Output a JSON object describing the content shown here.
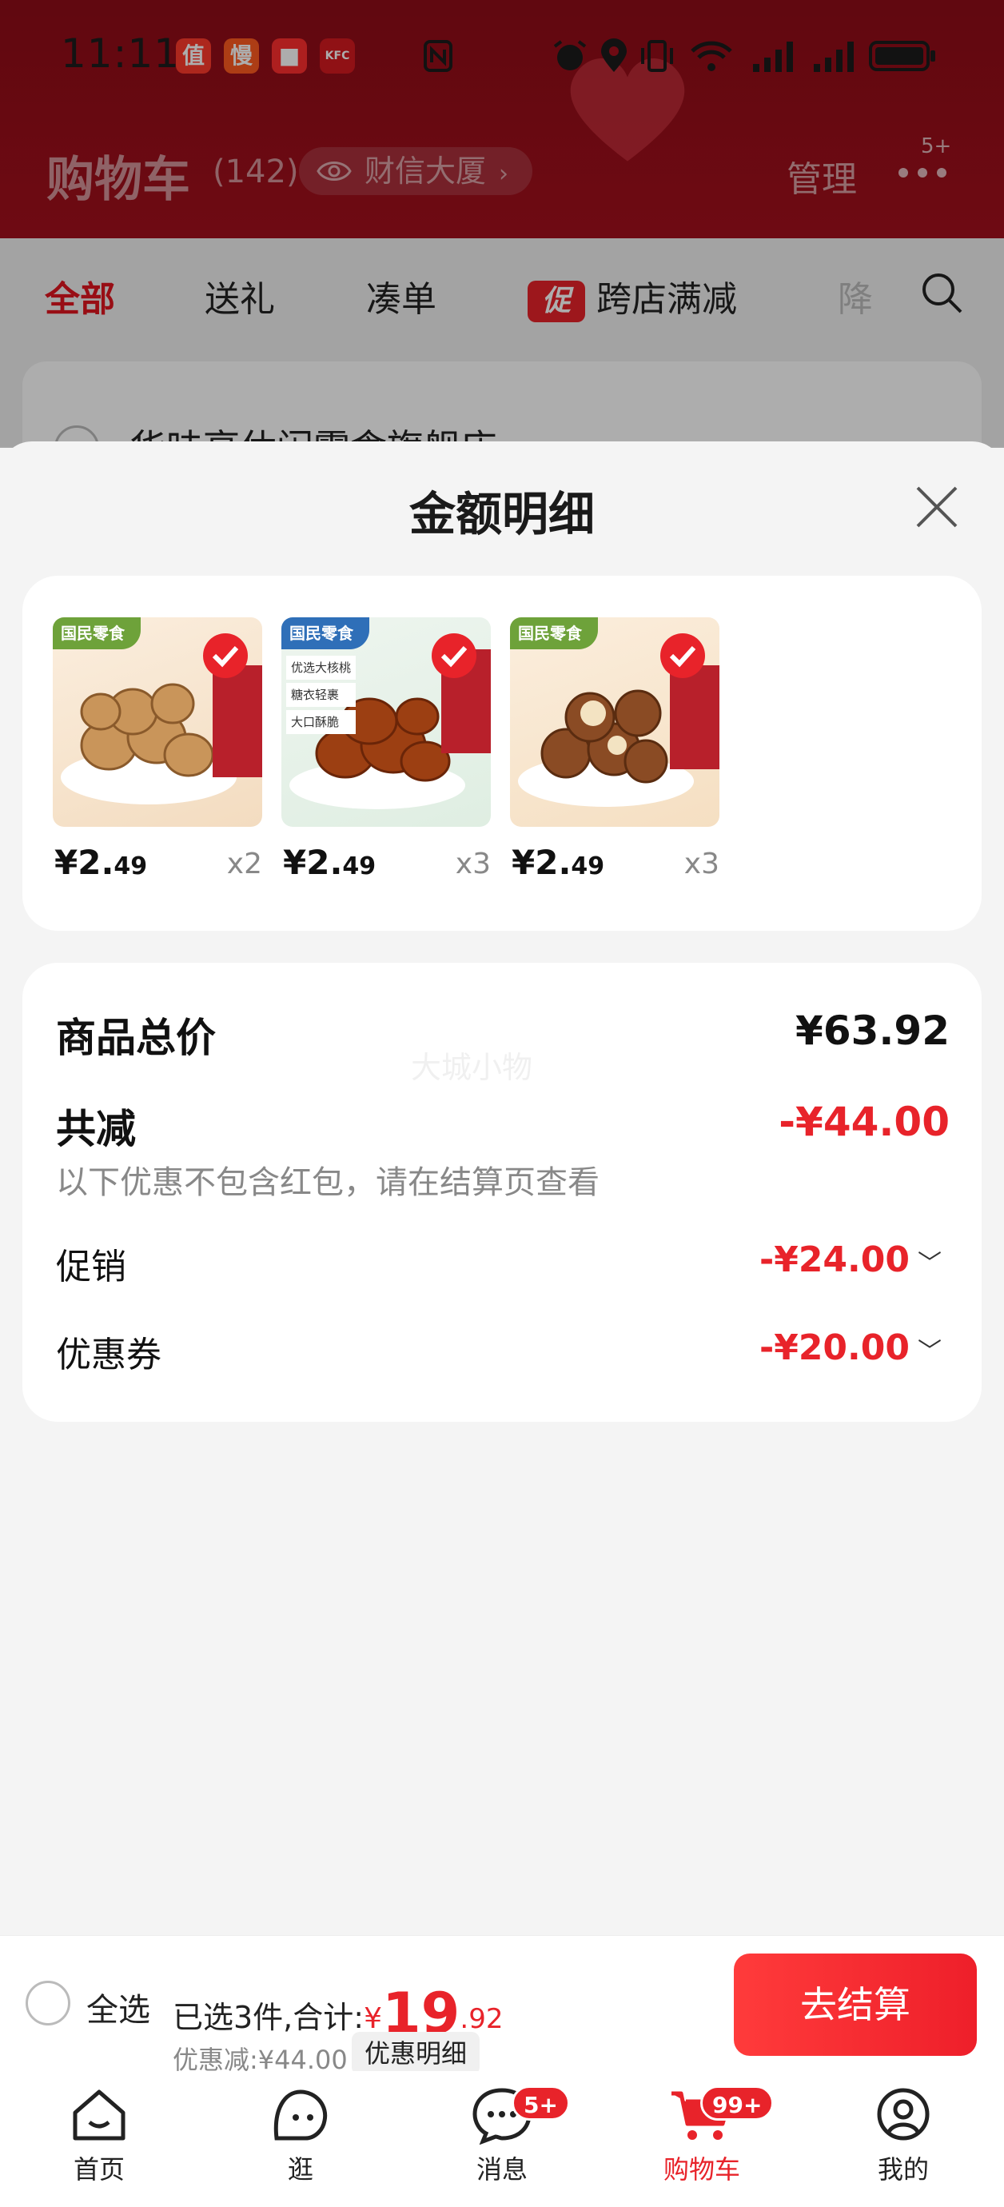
{
  "status_bar": {
    "time": "11:11",
    "app_icons": [
      "值",
      "慢",
      "■",
      "KFC"
    ]
  },
  "header": {
    "title": "购物车",
    "count": "(142)",
    "location": "财信大厦",
    "manage": "管理",
    "more_badge": "5+"
  },
  "tabs": {
    "all": "全部",
    "gift": "送礼",
    "bundle": "凑单",
    "promo_tag": "促",
    "cross_store": "跨店满减",
    "cut": "降"
  },
  "store": {
    "name": "华味亨休闲零食旗舰店"
  },
  "sheet": {
    "title": "金额明细",
    "watermark": "大城小物",
    "products": [
      {
        "brand": "国民零食",
        "price_int": "¥2.",
        "price_dec": "49",
        "qty": "x2",
        "theme": "walnut"
      },
      {
        "brand": "国民零食",
        "price_int": "¥2.",
        "price_dec": "49",
        "qty": "x3",
        "theme": "candied"
      },
      {
        "brand": "国民零食",
        "price_int": "¥2.",
        "price_dec": "49",
        "qty": "x3",
        "theme": "macadamia"
      }
    ],
    "candied_labels": [
      "优选大核桃",
      "糖衣轻裹",
      "大口酥脆"
    ],
    "summary": {
      "total_label": "商品总价",
      "total_value": "¥63.92",
      "discount_label": "共减",
      "discount_value": "-¥44.00",
      "note": "以下优惠不包含红包，请在结算页查看",
      "promo_label": "促销",
      "promo_value": "-¥24.00",
      "coupon_label": "优惠券",
      "coupon_value": "-¥20.00"
    }
  },
  "checkout": {
    "select_all": "全选",
    "selected_text": "已选3件,合计:",
    "yen": "¥",
    "amount_int": "19",
    "amount_dec": ".92",
    "discount_text": "优惠减:¥44.00",
    "detail_button": "优惠明细",
    "checkout_button": "去结算"
  },
  "nav": {
    "home": "首页",
    "browse": "逛",
    "messages": "消息",
    "messages_badge": "5+",
    "cart": "购物车",
    "cart_badge": "99+",
    "mine": "我的"
  },
  "colors": {
    "brand_red": "#e8232a",
    "header_red": "#a30f1c"
  }
}
